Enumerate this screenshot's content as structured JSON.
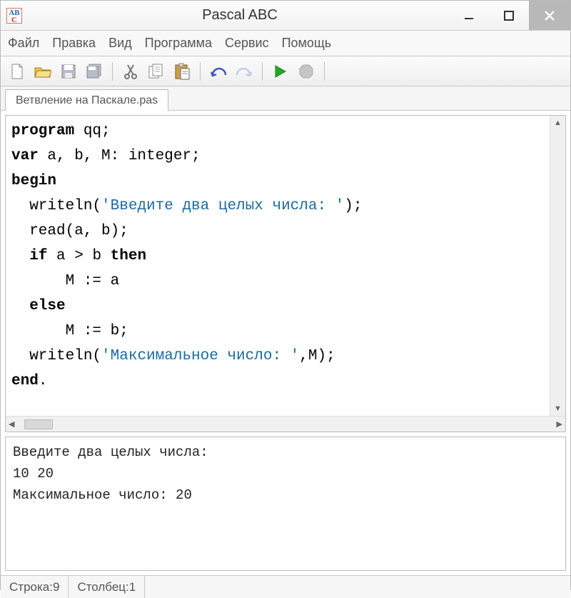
{
  "titlebar": {
    "title": "Pascal ABC"
  },
  "menu": {
    "file": "Файл",
    "edit": "Правка",
    "view": "Вид",
    "program": "Программа",
    "service": "Сервис",
    "help": "Помощь"
  },
  "tabs": {
    "t0": "Ветвление на Паскале.pas"
  },
  "code": {
    "kw_program": "program",
    "qq": " qq;",
    "kw_var": "var",
    "var_rest": " a, b, M: integer;",
    "kw_begin": "begin",
    "writeln1_pre": "  writeln(",
    "str1": "'Введите два целых числа: '",
    "writeln1_post": ");",
    "read": "  read(a, b);",
    "if_pre": "  ",
    "kw_if": "if",
    "if_mid": " a > b ",
    "kw_then": "then",
    "assign_a": "      M := a",
    "else_pre": "  ",
    "kw_else": "else",
    "assign_b": "      M := b;",
    "writeln2_pre": "  writeln(",
    "str2": "'Максимальное число: '",
    "writeln2_post": ",M);",
    "kw_end": "end",
    "end_dot": "."
  },
  "output": {
    "line1": "Введите два целых числа:",
    "line2": "10 20",
    "line3": "Максимальное число: 20"
  },
  "status": {
    "row_label": "Строка: ",
    "row_value": "9",
    "col_label": "Столбец: ",
    "col_value": "1"
  }
}
